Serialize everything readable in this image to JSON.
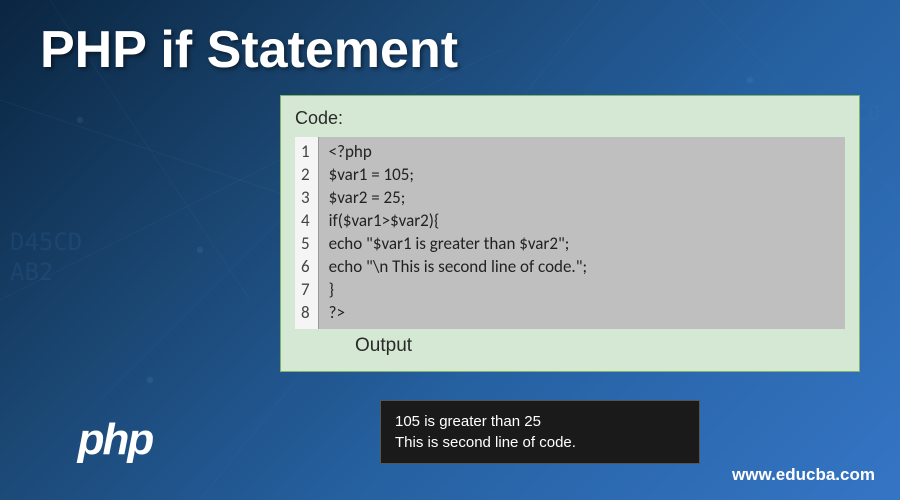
{
  "title": "PHP if Statement",
  "code": {
    "label": "Code:",
    "lines": [
      "<?php",
      "$var1 = 105;",
      "$var2 = 25;",
      "if($var1>$var2){",
      "echo \"$var1 is greater than $var2\";",
      "echo \"\\n This is second line of code.\";",
      "}",
      "?>"
    ]
  },
  "output": {
    "label": "Output",
    "lines": [
      "105 is greater than 25",
      "This is second line of code."
    ]
  },
  "logo_text": "php",
  "website": "www.educba.com"
}
